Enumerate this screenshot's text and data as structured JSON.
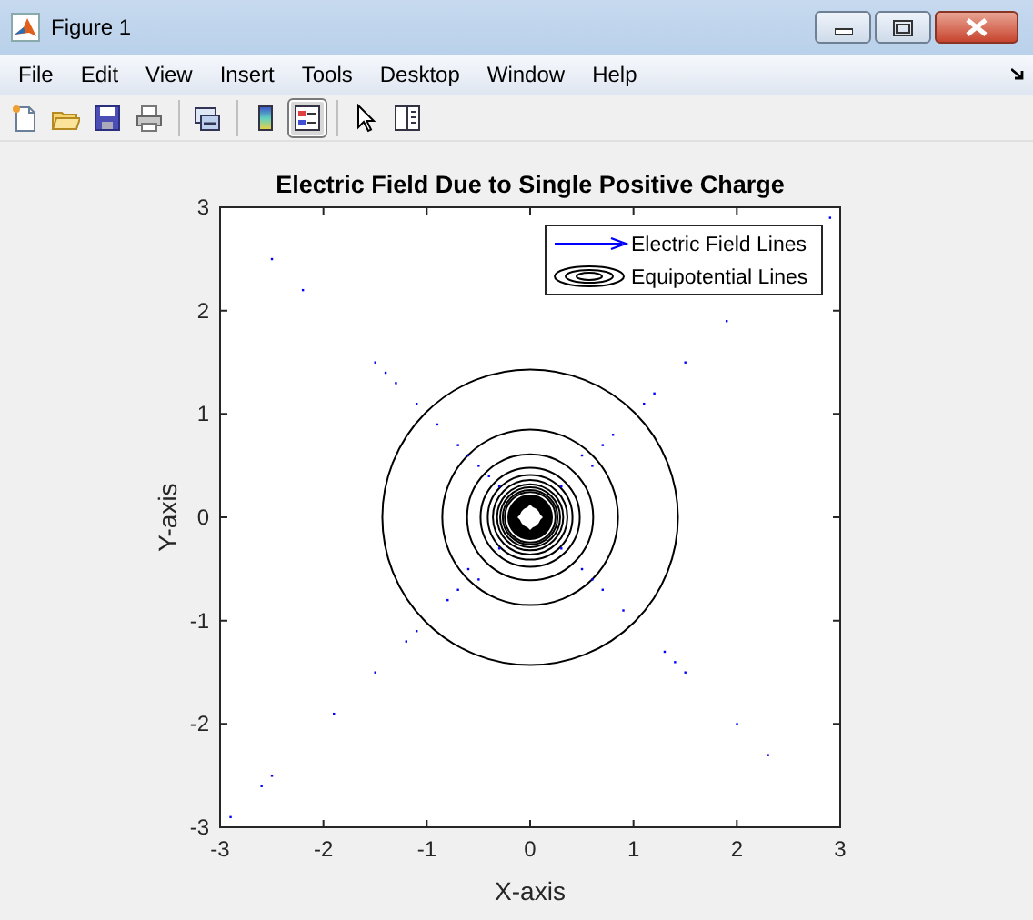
{
  "window": {
    "title": "Figure 1"
  },
  "menu": [
    "File",
    "Edit",
    "View",
    "Insert",
    "Tools",
    "Desktop",
    "Window",
    "Help"
  ],
  "toolbar": [
    {
      "kind": "new",
      "pressed": false
    },
    {
      "kind": "open",
      "pressed": false
    },
    {
      "kind": "save",
      "pressed": false
    },
    {
      "kind": "print",
      "pressed": false
    },
    {
      "kind": "sep"
    },
    {
      "kind": "link",
      "pressed": false
    },
    {
      "kind": "sep"
    },
    {
      "kind": "colorbar",
      "pressed": false
    },
    {
      "kind": "legend",
      "pressed": true
    },
    {
      "kind": "sep"
    },
    {
      "kind": "pointer",
      "pressed": false
    },
    {
      "kind": "plottools",
      "pressed": false
    }
  ],
  "plot": {
    "title": "Electric Field Due to Single Positive Charge",
    "xlabel": "X-axis",
    "ylabel": "Y-axis",
    "xticks": [
      "-3",
      "-2",
      "-1",
      "0",
      "1",
      "2",
      "3"
    ],
    "yticks": [
      "3",
      "2",
      "1",
      "0",
      "-1",
      "-2",
      "-3"
    ],
    "legend": [
      {
        "kind": "arrow",
        "label": "Electric Field Lines"
      },
      {
        "kind": "contour",
        "label": "Equipotential Lines"
      }
    ]
  }
}
